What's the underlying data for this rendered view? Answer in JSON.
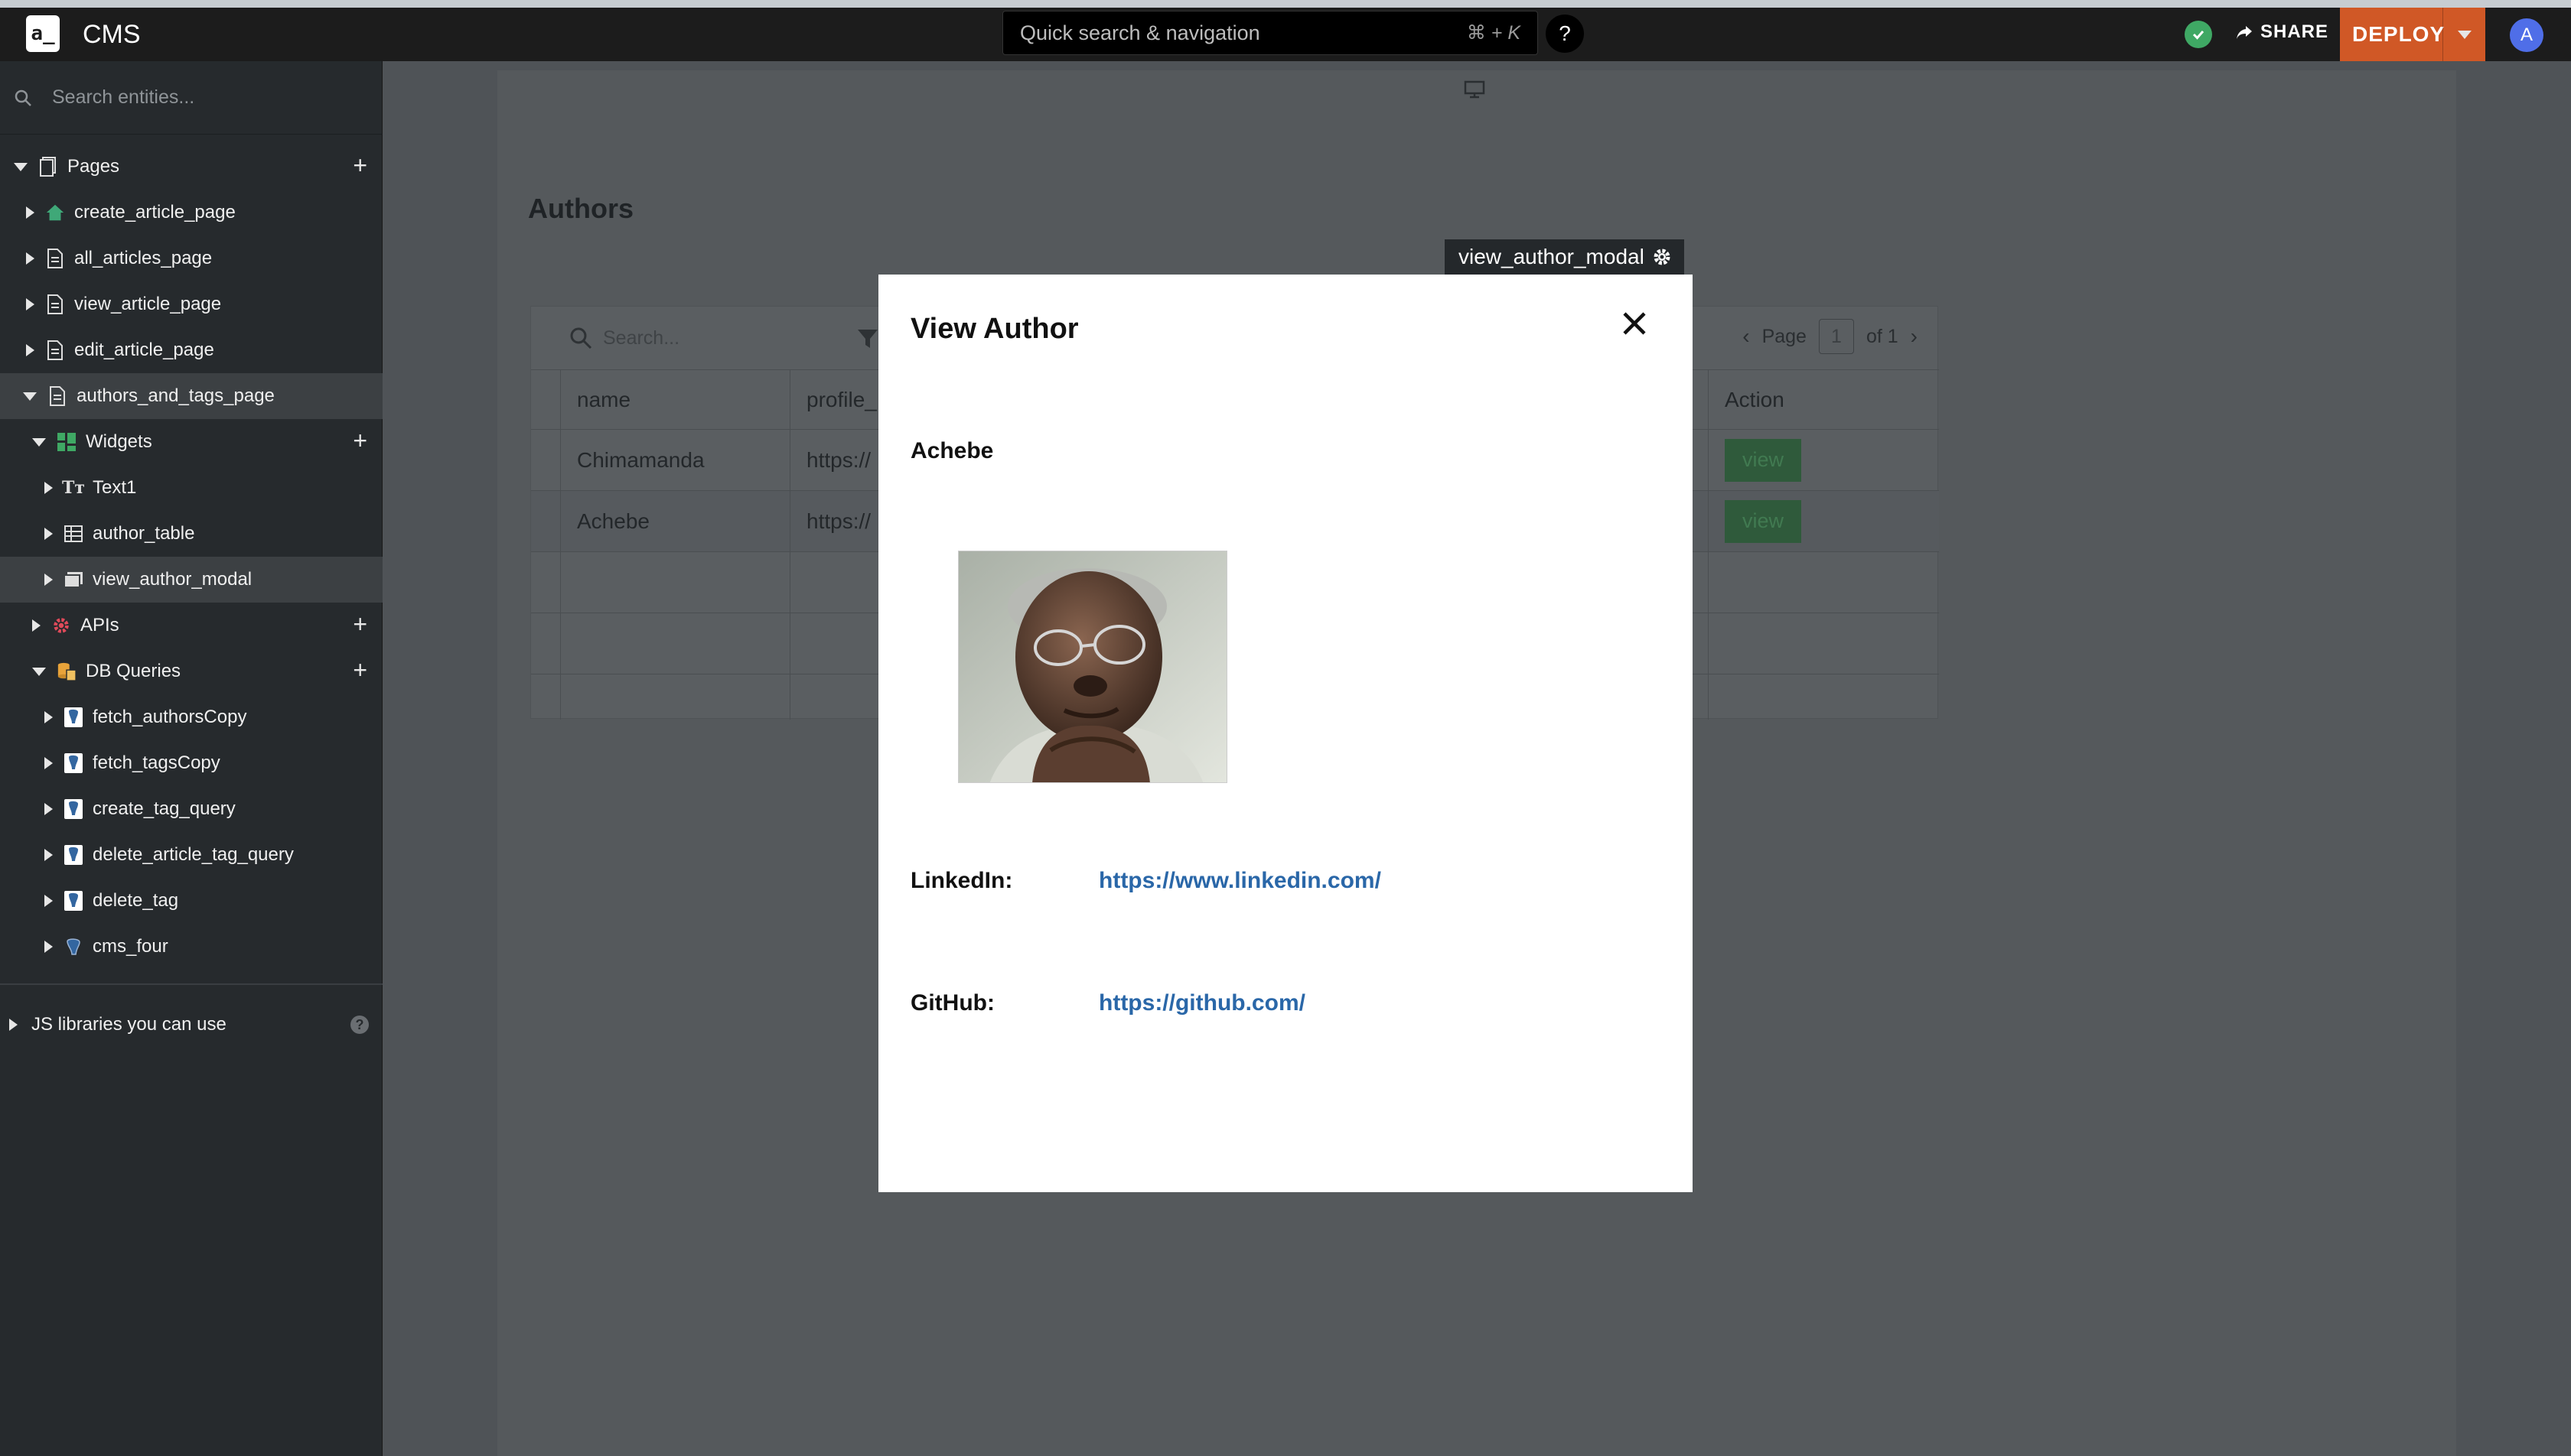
{
  "header": {
    "app_name": "CMS",
    "logo_text": "a_",
    "quick_search": {
      "placeholder": "Quick search & navigation",
      "shortcut": "⌘ + K"
    },
    "help": "?",
    "share_label": "SHARE",
    "deploy_label": "DEPLOY",
    "avatar_initial": "A"
  },
  "sidebar": {
    "search_placeholder": "Search entities...",
    "pages_label": "Pages",
    "pages": [
      "create_article_page",
      "all_articles_page",
      "view_article_page",
      "edit_article_page",
      "authors_and_tags_page"
    ],
    "widgets_label": "Widgets",
    "widgets": [
      "Text1",
      "author_table",
      "view_author_modal"
    ],
    "apis_label": "APIs",
    "db_queries_label": "DB Queries",
    "db_queries": [
      "fetch_authorsCopy",
      "fetch_tagsCopy",
      "create_tag_query",
      "delete_article_tag_query",
      "delete_tag",
      "cms_four"
    ],
    "js_libraries_label": "JS libraries you can use"
  },
  "canvas": {
    "heading": "Authors",
    "table": {
      "search_placeholder": "Search...",
      "page_label": "Page",
      "page_number": "1",
      "page_total": "of 1",
      "columns": [
        "name",
        "profile_",
        "Action"
      ],
      "rows": [
        {
          "name": "Chimamanda",
          "profile": "https://",
          "action": "view"
        },
        {
          "name": "Achebe",
          "profile": "https://",
          "action": "view"
        }
      ]
    }
  },
  "modal": {
    "tag_label": "view_author_modal",
    "title": "View Author",
    "author_name": "Achebe",
    "linkedin_label": "LinkedIn:",
    "linkedin_url": "https://www.linkedin.com/",
    "github_label": "GitHub:",
    "github_url": "https://github.com/"
  },
  "colors": {
    "deploy": "#d05826",
    "link": "#2a67a8",
    "success": "#3fa864",
    "avatar": "#4f6ee8"
  }
}
